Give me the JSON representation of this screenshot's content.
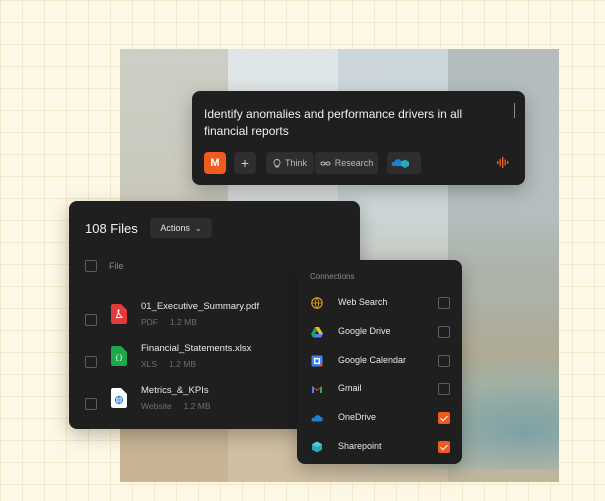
{
  "prompt": {
    "text": "Identify anomalies and performance drivers in all financial reports",
    "think_label": "Think",
    "research_label": "Research",
    "plus_label": "+",
    "logo_letter": "M"
  },
  "files": {
    "title": "108 Files",
    "actions_label": "Actions",
    "column_file": "File",
    "items": [
      {
        "name": "01_Executive_Summary.pdf",
        "type": "PDF",
        "size": "1.2 MB",
        "icon": "pdf-icon",
        "color": "#e23b3b"
      },
      {
        "name": "Financial_Statements.xlsx",
        "type": "XLS",
        "size": "1.2 MB",
        "icon": "spreadsheet-icon",
        "color": "#1fa84a"
      },
      {
        "name": "Metrics_&_KPIs",
        "type": "Website",
        "size": "1.2 MB",
        "icon": "website-icon",
        "color": "#ffffff"
      }
    ]
  },
  "connections": {
    "title": "Connections",
    "items": [
      {
        "label": "Web Search",
        "icon": "globe-icon",
        "checked": false
      },
      {
        "label": "Google Drive",
        "icon": "google-drive-icon",
        "checked": false
      },
      {
        "label": "Google Calendar",
        "icon": "google-calendar-icon",
        "checked": false
      },
      {
        "label": "Gmail",
        "icon": "gmail-icon",
        "checked": false
      },
      {
        "label": "OneDrive",
        "icon": "onedrive-icon",
        "checked": true
      },
      {
        "label": "Sharepoint",
        "icon": "sharepoint-icon",
        "checked": true
      }
    ]
  },
  "colors": {
    "accent": "#ee5b1f",
    "panel": "#1f1f1f"
  }
}
